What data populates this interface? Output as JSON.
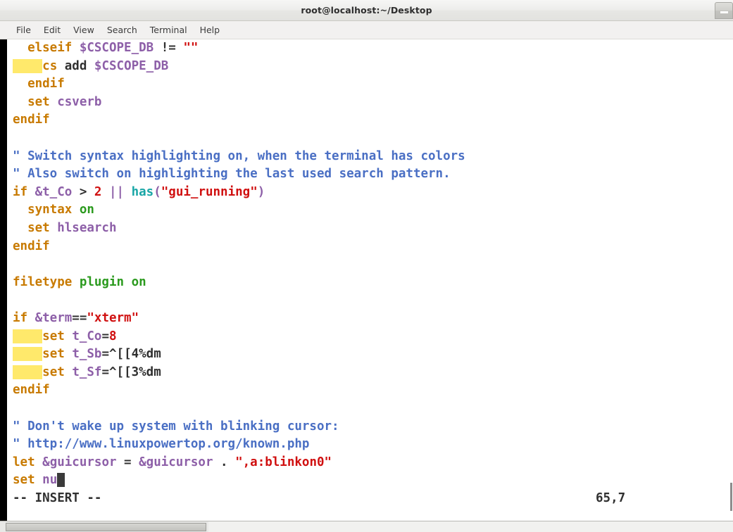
{
  "window": {
    "title": "root@localhost:~/Desktop",
    "minimize_label": "minimize"
  },
  "menubar": {
    "items": [
      {
        "label": "File"
      },
      {
        "label": "Edit"
      },
      {
        "label": "View"
      },
      {
        "label": "Search"
      },
      {
        "label": "Terminal"
      },
      {
        "label": "Help"
      }
    ]
  },
  "editor": {
    "app": "vim",
    "mode_text": "-- INSERT --",
    "ruler": "65,7",
    "cursor": {
      "line": 65,
      "column": 7
    },
    "search_highlight_color": "#ffe96b",
    "background_color": "#ffffff",
    "lines": [
      {
        "tokens": [
          {
            "t": "  elseif ",
            "c": "keyword"
          },
          {
            "t": "$CSCOPE_DB",
            "c": "option"
          },
          {
            "t": " != ",
            "c": "normal"
          },
          {
            "t": "\"\"",
            "c": "string"
          }
        ]
      },
      {
        "tokens": [
          {
            "t": "    ",
            "c": "hl-search"
          },
          {
            "t": "cs ",
            "c": "keyword"
          },
          {
            "t": "add ",
            "c": "normal"
          },
          {
            "t": "$CSCOPE_DB",
            "c": "option"
          }
        ]
      },
      {
        "tokens": [
          {
            "t": "  endif",
            "c": "keyword"
          }
        ]
      },
      {
        "tokens": [
          {
            "t": "  set ",
            "c": "keyword"
          },
          {
            "t": "csverb",
            "c": "option"
          }
        ]
      },
      {
        "tokens": [
          {
            "t": "endif",
            "c": "keyword"
          }
        ]
      },
      {
        "tokens": []
      },
      {
        "tokens": [
          {
            "t": "\" Switch syntax highlighting on, when the terminal has colors",
            "c": "comment"
          }
        ]
      },
      {
        "tokens": [
          {
            "t": "\" Also switch on highlighting the last used search pattern.",
            "c": "comment"
          }
        ]
      },
      {
        "tokens": [
          {
            "t": "if ",
            "c": "keyword"
          },
          {
            "t": "&t_Co",
            "c": "option"
          },
          {
            "t": " > ",
            "c": "normal"
          },
          {
            "t": "2",
            "c": "number"
          },
          {
            "t": " || ",
            "c": "operator"
          },
          {
            "t": "has",
            "c": "func"
          },
          {
            "t": "(",
            "c": "operator"
          },
          {
            "t": "\"gui_running\"",
            "c": "string"
          },
          {
            "t": ")",
            "c": "operator"
          }
        ]
      },
      {
        "tokens": [
          {
            "t": "  syntax ",
            "c": "keyword"
          },
          {
            "t": "on",
            "c": "const"
          }
        ]
      },
      {
        "tokens": [
          {
            "t": "  set ",
            "c": "keyword"
          },
          {
            "t": "hlsearch",
            "c": "option"
          }
        ]
      },
      {
        "tokens": [
          {
            "t": "endif",
            "c": "keyword"
          }
        ]
      },
      {
        "tokens": []
      },
      {
        "tokens": [
          {
            "t": "filetype ",
            "c": "keyword"
          },
          {
            "t": "plugin on",
            "c": "const"
          }
        ]
      },
      {
        "tokens": []
      },
      {
        "tokens": [
          {
            "t": "if ",
            "c": "keyword"
          },
          {
            "t": "&term",
            "c": "option"
          },
          {
            "t": "==",
            "c": "normal"
          },
          {
            "t": "\"xterm\"",
            "c": "string"
          }
        ]
      },
      {
        "tokens": [
          {
            "t": "    ",
            "c": "hl-search"
          },
          {
            "t": "set ",
            "c": "keyword"
          },
          {
            "t": "t_Co",
            "c": "option"
          },
          {
            "t": "=",
            "c": "normal"
          },
          {
            "t": "8",
            "c": "number"
          }
        ]
      },
      {
        "tokens": [
          {
            "t": "    ",
            "c": "hl-search"
          },
          {
            "t": "set ",
            "c": "keyword"
          },
          {
            "t": "t_Sb",
            "c": "option"
          },
          {
            "t": "=^[[4%dm",
            "c": "normal"
          }
        ]
      },
      {
        "tokens": [
          {
            "t": "    ",
            "c": "hl-search"
          },
          {
            "t": "set ",
            "c": "keyword"
          },
          {
            "t": "t_Sf",
            "c": "option"
          },
          {
            "t": "=^[[3%dm",
            "c": "normal"
          }
        ]
      },
      {
        "tokens": [
          {
            "t": "endif",
            "c": "keyword"
          }
        ]
      },
      {
        "tokens": []
      },
      {
        "tokens": [
          {
            "t": "\" Don't wake up system with blinking cursor:",
            "c": "comment"
          }
        ]
      },
      {
        "tokens": [
          {
            "t": "\" http://www.linuxpowertop.org/known.php",
            "c": "comment"
          }
        ]
      },
      {
        "tokens": [
          {
            "t": "let ",
            "c": "keyword"
          },
          {
            "t": "&guicursor",
            "c": "option"
          },
          {
            "t": " = ",
            "c": "normal"
          },
          {
            "t": "&guicursor",
            "c": "option"
          },
          {
            "t": " . ",
            "c": "normal"
          },
          {
            "t": "\",a:blinkon0\"",
            "c": "string"
          }
        ]
      },
      {
        "tokens": [
          {
            "t": "set ",
            "c": "keyword"
          },
          {
            "t": "nu",
            "c": "option"
          },
          {
            "t": " ",
            "c": "cursor-block"
          }
        ]
      }
    ]
  }
}
